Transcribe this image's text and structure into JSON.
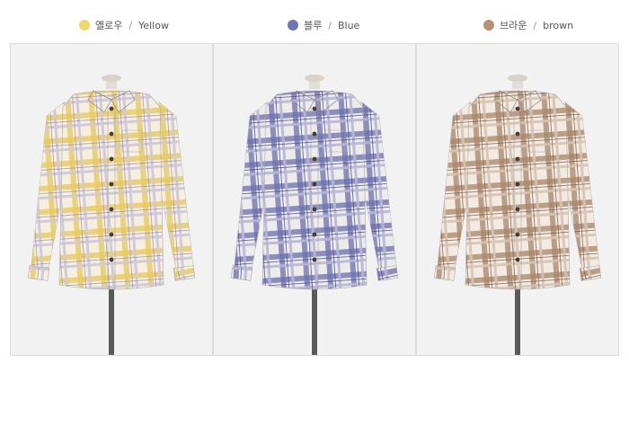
{
  "colors": [
    {
      "id": "yellow",
      "swatch": "#f1d76a",
      "label_ko": "옐로우",
      "separator": "/",
      "label_en": "Yellow",
      "fabric": {
        "base": "#f4efe1",
        "stripe": "#e7c85a",
        "stripe2": "#cfc7da",
        "thin": "#9a8fb0"
      }
    },
    {
      "id": "blue",
      "swatch": "#6f77b3",
      "label_ko": "블루",
      "separator": "/",
      "label_en": "Blue",
      "fabric": {
        "base": "#eeece8",
        "stripe": "#6b6eb0",
        "stripe2": "#b7b6d9",
        "thin": "#3f438a"
      }
    },
    {
      "id": "brown",
      "swatch": "#b69273",
      "label_ko": "브라운",
      "separator": "/",
      "label_en": "brown",
      "fabric": {
        "base": "#f1ebe4",
        "stripe": "#a88466",
        "stripe2": "#d7c3b1",
        "thin": "#7a5a44"
      }
    }
  ]
}
